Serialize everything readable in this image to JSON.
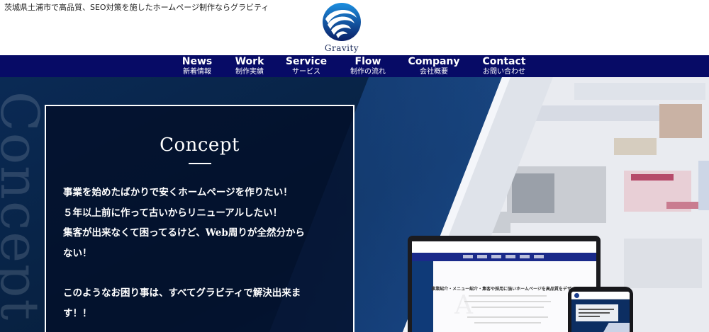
{
  "header": {
    "tagline": "茨城県土浦市で高品質、SEO対策を施したホームページ制作ならグラビティ",
    "logo_text": "Gravity",
    "logo_icon": "gravity-swirl-logo"
  },
  "nav": {
    "items": [
      {
        "en": "News",
        "ja": "新着情報"
      },
      {
        "en": "Work",
        "ja": "制作実績"
      },
      {
        "en": "Service",
        "ja": "サービス"
      },
      {
        "en": "Flow",
        "ja": "制作の流れ"
      },
      {
        "en": "Company",
        "ja": "会社概要"
      },
      {
        "en": "Contact",
        "ja": "お問い合わせ"
      }
    ]
  },
  "hero": {
    "watermark": "Concept",
    "concept": {
      "title": "Concept",
      "lines": [
        "事業を始めたばかりで安くホームページを作りたい！",
        "５年以上前に作って古いからリニューアルしたい！",
        "集客が出来なくて困ってるけど、Web周りが全然分から",
        "ない！",
        "このようなお困り事は、すべてグラビティで解決出来ま",
        "す！！"
      ]
    },
    "laptop": {
      "headline": "事業紹介・メニュー紹介・集客や採用に強いホームページを高品質をデザインで！！"
    }
  },
  "colors": {
    "nav_bg": "#070b66",
    "hero_dark": "#0b2348",
    "hero_blue": "#1e4f9a",
    "text_on_dark": "#ffffff"
  }
}
